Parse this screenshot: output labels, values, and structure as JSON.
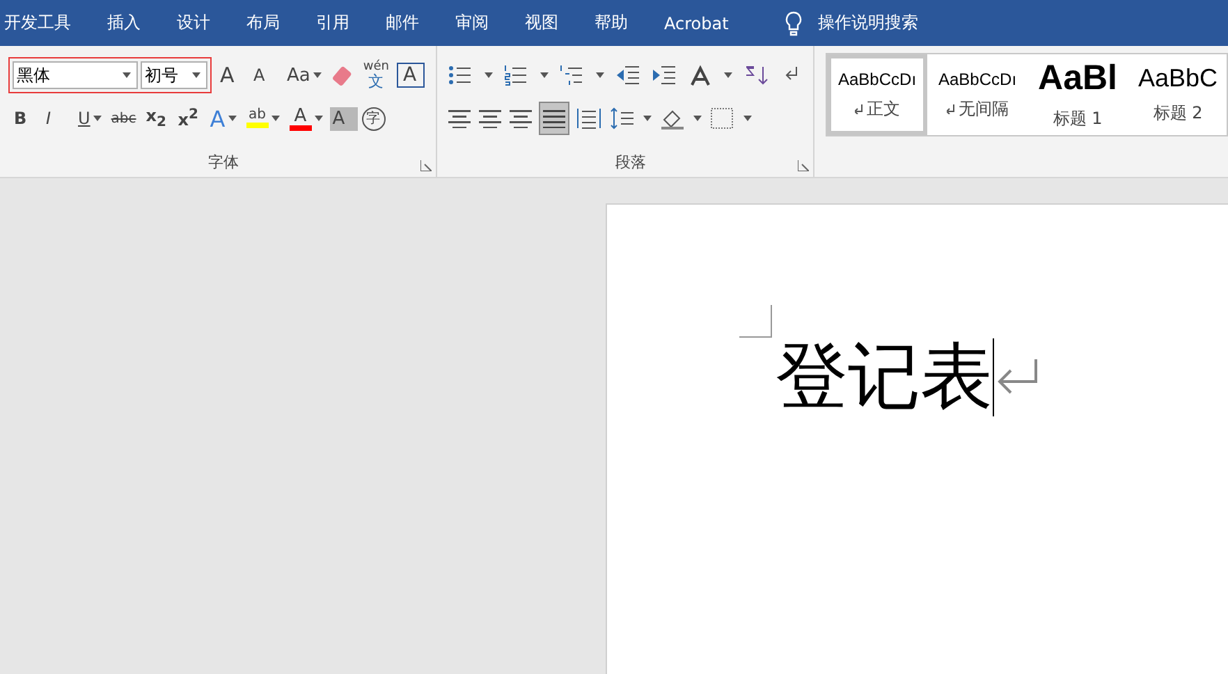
{
  "menu_tabs": [
    {
      "label": "开发工具"
    },
    {
      "label": "插入"
    },
    {
      "label": "设计"
    },
    {
      "label": "布局"
    },
    {
      "label": "引用"
    },
    {
      "label": "邮件"
    },
    {
      "label": "审阅"
    },
    {
      "label": "视图"
    },
    {
      "label": "帮助"
    },
    {
      "label": "Acrobat"
    }
  ],
  "tell_me": "操作说明搜索",
  "font_group": {
    "font_name": "黑体",
    "font_size": "初号",
    "highlighted": true,
    "row1": [
      {
        "kind": "grow",
        "label": "A"
      },
      {
        "kind": "shrink",
        "label": "A"
      },
      {
        "kind": "case",
        "label": "Aa"
      },
      {
        "kind": "eraser"
      },
      {
        "kind": "phonetic",
        "label": "wén",
        "sub": "文"
      },
      {
        "kind": "border",
        "label": "A"
      }
    ],
    "row2": [
      {
        "kind": "bold",
        "label": "B"
      },
      {
        "kind": "italic",
        "label": "I"
      },
      {
        "kind": "underline",
        "label": "U"
      },
      {
        "kind": "strike",
        "label": "abc"
      },
      {
        "kind": "rich",
        "label": "x$_{2}$"
      },
      {
        "kind": "rich",
        "label": "x$^{2}$"
      },
      {
        "kind": "effect",
        "label": "A"
      },
      {
        "kind": "highlight",
        "label": "ab",
        "color": "#ffff00"
      },
      {
        "kind": "fontcolor",
        "label": "A",
        "color": "#ff0000"
      },
      {
        "kind": "shade",
        "label": "A"
      },
      {
        "kind": "enclose",
        "label": "字"
      }
    ],
    "title": "字体"
  },
  "paragraph_group": {
    "title": "段落",
    "justify_selected": true
  },
  "styles": [
    {
      "preview": "AaBbCcDı",
      "label": "正文",
      "kind": "normal",
      "paragraph_mark": true,
      "selected": true
    },
    {
      "preview": "AaBbCcDı",
      "label": "无间隔",
      "kind": "normal",
      "paragraph_mark": true,
      "selected": false
    },
    {
      "preview": "AaBl",
      "label": "标题 1",
      "kind": "heading1",
      "paragraph_mark": false,
      "selected": false
    },
    {
      "preview": "AaBbC",
      "label": "标题 2",
      "kind": "heading2",
      "paragraph_mark": false,
      "selected": false
    }
  ],
  "document": {
    "text": "登记表"
  }
}
